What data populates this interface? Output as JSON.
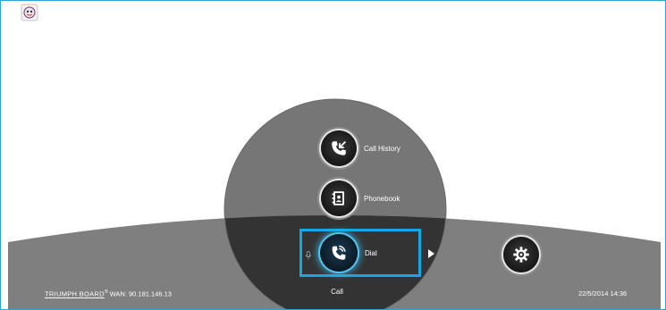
{
  "app": {
    "icon": "tray-app-icon"
  },
  "menu": {
    "items": [
      {
        "label": "Call History",
        "icon": "call-history-icon"
      },
      {
        "label": "Phonebook",
        "icon": "phonebook-icon"
      },
      {
        "label": "Dial",
        "icon": "dial-icon",
        "selected": true
      }
    ],
    "center_label": "Call",
    "settings_icon": "gear-icon",
    "next_icon": "play-arrow-icon",
    "mic_icon": "microphone-icon"
  },
  "footer": {
    "brand": "TRIUMPH BOARD",
    "reg": "®",
    "wan": "WAN: 90.181.146.13",
    "datetime": "22/5/2014 14:36"
  },
  "colors": {
    "accent": "#14a7e0",
    "dome_outer": "#808080",
    "dome_center": "#303030",
    "circle_upper": "#747474",
    "background": "#ffffff"
  }
}
